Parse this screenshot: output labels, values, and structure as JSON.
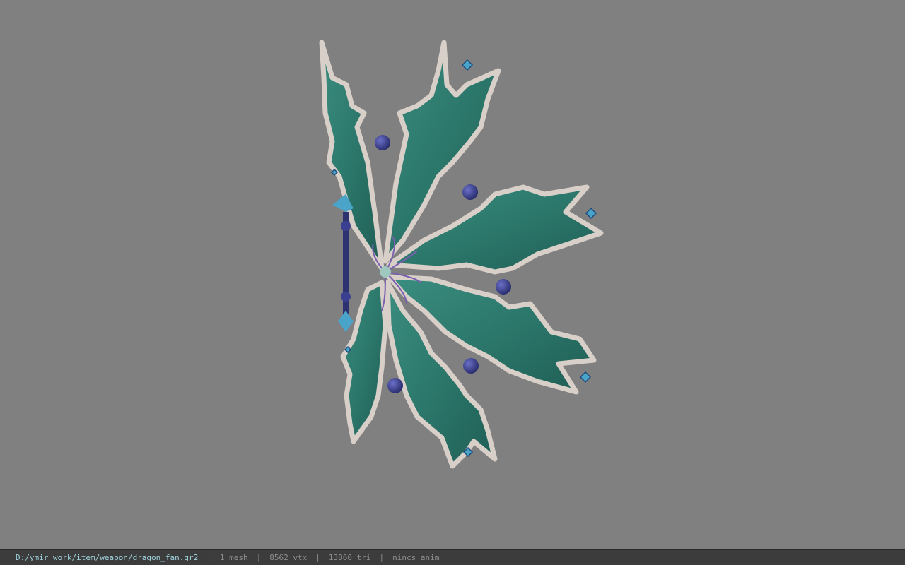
{
  "viewport": {
    "background": "#808080",
    "model": {
      "leaf_fill": "#2f7f72",
      "leaf_edge": "#d8cfc8",
      "orb_color": "#3b3f8f",
      "gem_color": "#4aa3c9",
      "handle_color": "#2d3370"
    }
  },
  "status_bar": {
    "file_path": "D:/ymir work/item/weapon/dragon_fan.gr2",
    "separator": "|",
    "mesh_count": "1 mesh",
    "vertex_count": "8562 vtx",
    "triangle_count": "13860 tri",
    "anim_info": "nincs anim"
  }
}
